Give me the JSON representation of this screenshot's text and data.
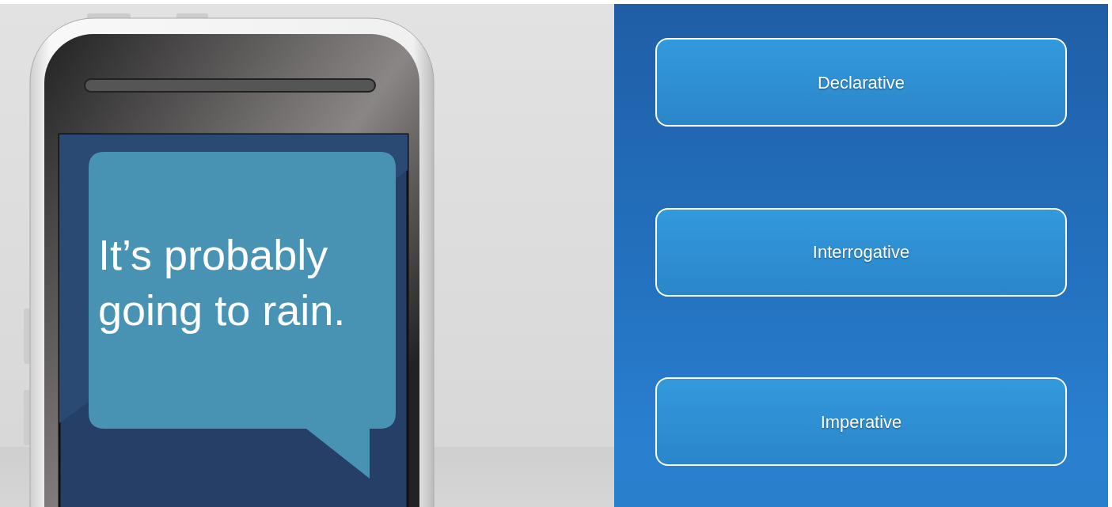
{
  "message": {
    "text": "It’s probably going to rain."
  },
  "choices": [
    {
      "label": "Declarative"
    },
    {
      "label": "Interrogative"
    },
    {
      "label": "Imperative"
    }
  ]
}
